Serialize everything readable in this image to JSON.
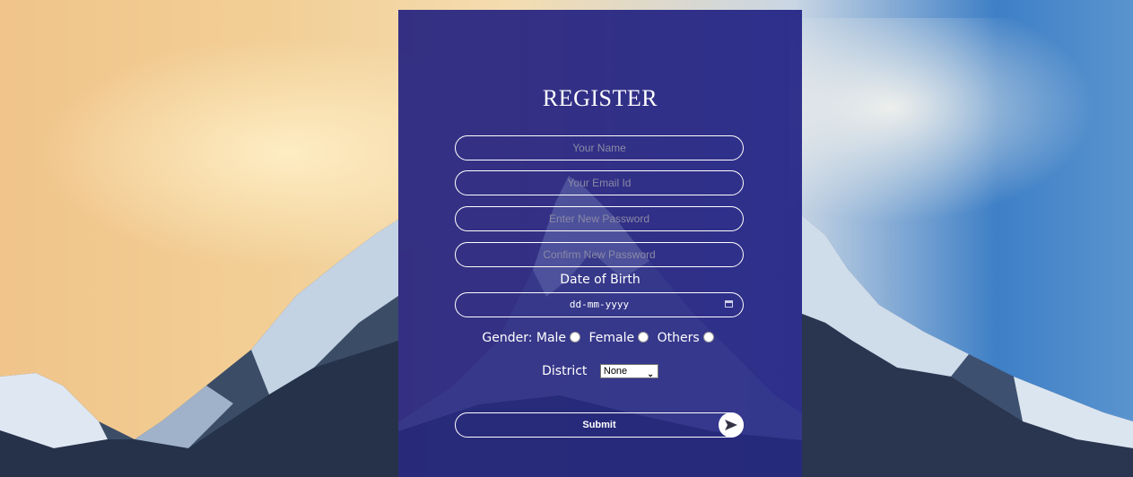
{
  "form": {
    "title": "REGISTER",
    "name_placeholder": "Your Name",
    "email_placeholder": "Your Email Id",
    "password_placeholder": "Enter New Password",
    "confirm_password_placeholder": "Confirm New Password",
    "dob_label": "Date of Birth",
    "dob_value": "dd-mm-yyyy",
    "gender_label": "Gender:",
    "gender_options": [
      "Male",
      "Female",
      "Others"
    ],
    "district_label": "District",
    "district_selected": "None",
    "submit_label": "Submit"
  },
  "icons": {
    "calendar": "calendar-icon",
    "submit_arrow": "send-arrow-icon"
  },
  "colors": {
    "card_background": "#14147d",
    "text": "#ffffff",
    "placeholder": "#8a8aa6"
  }
}
